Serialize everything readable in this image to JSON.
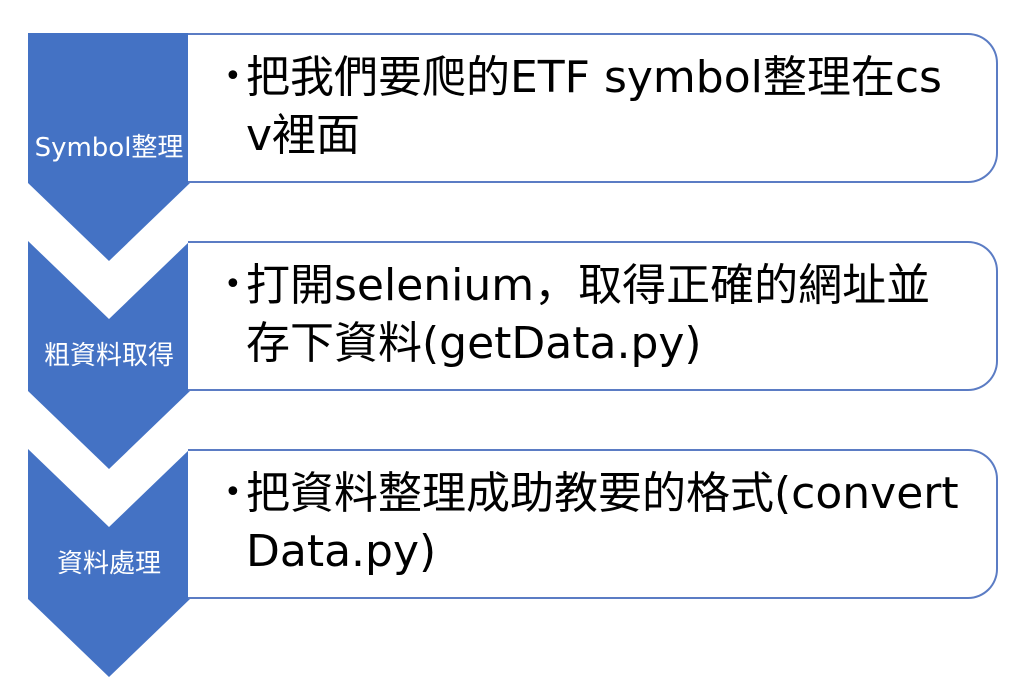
{
  "colors": {
    "chevron_fill": "#4472c4",
    "box_border": "#5b7cc4",
    "text": "#000000",
    "chevron_text": "#ffffff"
  },
  "steps": [
    {
      "label": "Symbol整理",
      "bullet": "•",
      "text": "把我們要爬的ETF symbol整理在csv裡面"
    },
    {
      "label": "粗資料取得",
      "bullet": "•",
      "text": "打開selenium，取得正確的網址並存下資料(getData.py)"
    },
    {
      "label": "資料處理",
      "bullet": "•",
      "text": "把資料整理成助教要的格式(convertData.py)"
    }
  ]
}
